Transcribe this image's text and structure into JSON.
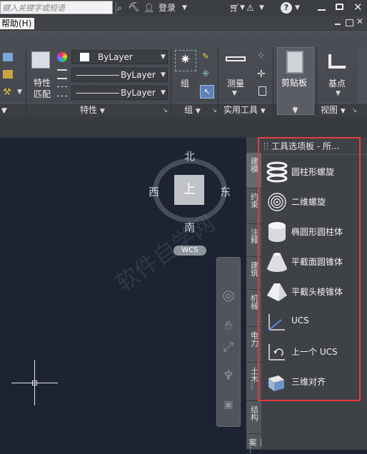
{
  "titlebar": {
    "search_placeholder": "键入关键字或短语",
    "login": "登录",
    "help_icon": "?"
  },
  "menubar": {
    "help": "帮助(H)"
  },
  "ribbon": {
    "match_props": "特性匹配",
    "bylayer_color": "ByLayer",
    "bylayer_linetype": "ByLayer",
    "bylayer_lineweight": "ByLayer",
    "group": "组",
    "measure": "测量",
    "clipboard": "剪贴板",
    "base": "基点",
    "panels": {
      "properties": "特性",
      "group": "组",
      "utilities": "实用工具",
      "view": "视图"
    }
  },
  "viewcube": {
    "north": "北",
    "south": "南",
    "west": "西",
    "east": "东",
    "top": "上",
    "wcs": "WCS"
  },
  "palette": {
    "title": "工具选项板 - 所...",
    "tabs": [
      "建模",
      "约束",
      "注释",
      "建筑",
      "机械",
      "电力",
      "土木...",
      "结构",
      "图案..."
    ],
    "items": [
      {
        "label": "圆柱形螺旋",
        "icon": "helix-icon"
      },
      {
        "label": "二维螺旋",
        "icon": "spiral-icon"
      },
      {
        "label": "椭圆形圆柱体",
        "icon": "elliptical-cylinder-icon"
      },
      {
        "label": "平截面圆锥体",
        "icon": "frustum-cone-icon"
      },
      {
        "label": "平截头棱锥体",
        "icon": "frustum-pyramid-icon"
      },
      {
        "label": "UCS",
        "icon": "ucs-icon"
      },
      {
        "label": "上一个 UCS",
        "icon": "ucs-previous-icon"
      },
      {
        "label": "三维对齐",
        "icon": "3d-align-icon"
      }
    ]
  },
  "colors": {
    "highlight_box": "#e53b3b",
    "canvas": "#1d2333"
  }
}
